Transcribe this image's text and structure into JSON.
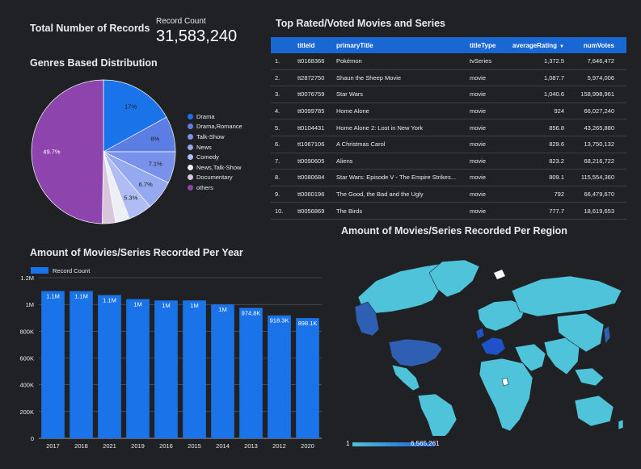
{
  "scorecard": {
    "title": "Total Number of Records",
    "label": "Record Count",
    "value": "31,583,240"
  },
  "genres": {
    "title": "Genres Based Distribution",
    "legend": [
      {
        "label": "Drama",
        "color": "#1a73e8"
      },
      {
        "label": "Drama,Romance",
        "color": "#5c7ee4"
      },
      {
        "label": "Talk-Show",
        "color": "#7891ea"
      },
      {
        "label": "News",
        "color": "#94a9f0"
      },
      {
        "label": "Comedy",
        "color": "#b0bcf4"
      },
      {
        "label": "News,Talk-Show",
        "color": "#eceff3"
      },
      {
        "label": "Documentary",
        "color": "#d8c7dc"
      },
      {
        "label": "others",
        "color": "#8e44ad"
      }
    ],
    "slice_labels": [
      "17%",
      "8%",
      "7.1%",
      "6.7%",
      "5.3%",
      "49.7%"
    ]
  },
  "chart_data": [
    {
      "type": "pie",
      "title": "Genres Based Distribution",
      "categories": [
        "Drama",
        "Drama,Romance",
        "Talk-Show",
        "News",
        "Comedy",
        "News,Talk-Show",
        "Documentary",
        "others"
      ],
      "values": [
        17,
        8,
        7.1,
        6.7,
        5.3,
        3.2,
        3.0,
        49.7
      ],
      "colors": [
        "#1a73e8",
        "#5c7ee4",
        "#7891ea",
        "#94a9f0",
        "#b0bcf4",
        "#eceff3",
        "#d8c7dc",
        "#8e44ad"
      ],
      "legend_position": "right"
    },
    {
      "type": "bar",
      "title": "Amount of Movies/Series Recorded Per Year",
      "categories": [
        "2017",
        "2018",
        "2021",
        "2019",
        "2016",
        "2015",
        "2014",
        "2013",
        "2012",
        "2020"
      ],
      "series": [
        {
          "name": "Record Count",
          "values": [
            1100000,
            1100000,
            1070000,
            1040000,
            1030000,
            1030000,
            1000000,
            974800,
            918300,
            898100
          ],
          "labels": [
            "1.1M",
            "1.1M",
            "1.1M",
            "1M",
            "1M",
            "1M",
            "1M",
            "974.8K",
            "918.3K",
            "898.1K"
          ]
        }
      ],
      "ylim": [
        0,
        1200000
      ],
      "yticks": [
        "0",
        "200K",
        "400K",
        "600K",
        "800K",
        "1M",
        "1.2M"
      ],
      "grid": true,
      "color": "#1a73e8",
      "legend_position": "top-left"
    }
  ],
  "table": {
    "title": "Top Rated/Voted Movies and Series",
    "columns": [
      "",
      "titleId",
      "primaryTitle",
      "titleType",
      "averageRating",
      "numVotes"
    ],
    "sort_indicator": "▼",
    "rows": [
      [
        "1.",
        "tt0168366",
        "Pokémon",
        "tvSeries",
        "1,372.5",
        "7,646,472"
      ],
      [
        "2.",
        "tt2872750",
        "Shaun the Sheep Movie",
        "movie",
        "1,087.7",
        "5,974,006"
      ],
      [
        "3.",
        "tt0076759",
        "Star Wars",
        "movie",
        "1,040.6",
        "158,998,961"
      ],
      [
        "4.",
        "tt0099785",
        "Home Alone",
        "movie",
        "924",
        "66,027,240"
      ],
      [
        "5.",
        "tt0104431",
        "Home Alone 2: Lost in New York",
        "movie",
        "856.8",
        "43,265,880"
      ],
      [
        "6.",
        "tt1067106",
        "A Christmas Carol",
        "movie",
        "829.6",
        "13,750,132"
      ],
      [
        "7.",
        "tt0090605",
        "Aliens",
        "movie",
        "823.2",
        "68,216,722"
      ],
      [
        "8.",
        "tt0080684",
        "Star Wars: Episode V - The Empire Strikes...",
        "movie",
        "809.1",
        "115,554,360"
      ],
      [
        "9.",
        "tt0060196",
        "The Good, the Bad and the Ugly",
        "movie",
        "792",
        "66,479,670"
      ],
      [
        "10.",
        "tt0056869",
        "The Birds",
        "movie",
        "777.7",
        "18,619,653"
      ]
    ]
  },
  "map": {
    "title": "Amount of Movies/Series Recorded Per Region",
    "scale_min": "1",
    "scale_max": "6,565,261",
    "color_low": "#4fc3d9",
    "color_high": "#1a56d6"
  }
}
